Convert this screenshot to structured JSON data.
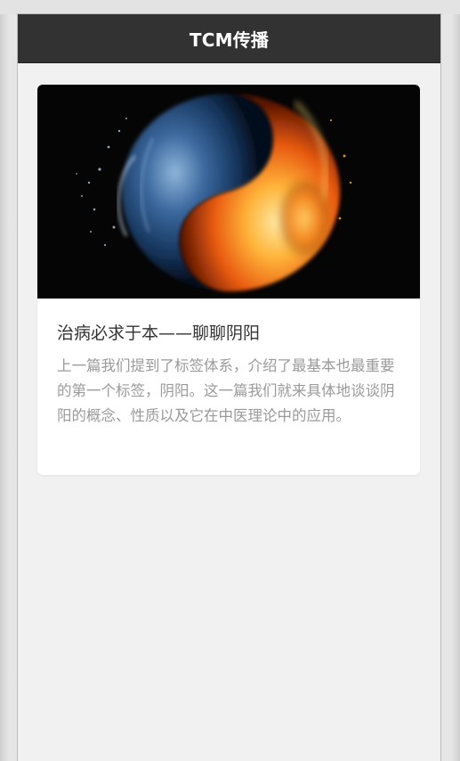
{
  "header": {
    "title": "TCM传播"
  },
  "article": {
    "image_subject": "yin-yang-water-and-fire-image",
    "title": "治病必求于本——聊聊阴阳",
    "summary": "上一篇我们提到了标签体系，介绍了最基本也最重要的第一个标签，阴阳。这一篇我们就来具体地谈谈阴阳的概念、性质以及它在中医理论中的应用。"
  },
  "colors": {
    "header_bg": "#323232",
    "page_bg": "#f1f1f1",
    "card_bg": "#ffffff",
    "title_text": "#333333",
    "summary_text": "#9a9a9a"
  }
}
